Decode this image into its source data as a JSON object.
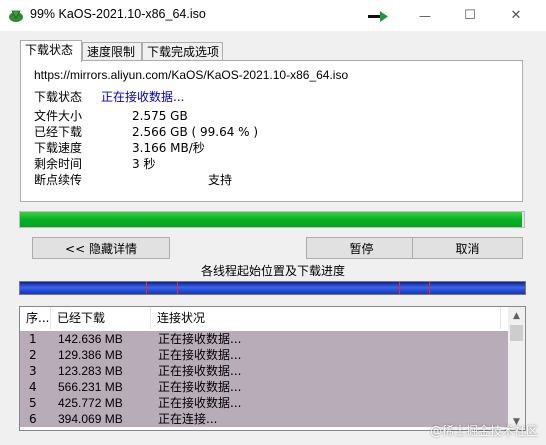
{
  "window": {
    "title": "99% KaOS-2021.10-x86_64.iso",
    "icon": "download-arrow-icon",
    "controls": {
      "minimize": "—",
      "maximize": "☐",
      "close": "✕"
    }
  },
  "tabs": [
    {
      "label": "下载状态",
      "active": true
    },
    {
      "label": "速度限制",
      "active": false
    },
    {
      "label": "下载完成选项",
      "active": false
    }
  ],
  "status": {
    "url": "https://mirrors.aliyun.com/KaOS/KaOS-2021.10-x86_64.iso",
    "status_label": "下载状态",
    "status_value": "正在接收数据...",
    "rows": [
      {
        "label": "文件大小",
        "value": "2.575  GB"
      },
      {
        "label": "已经下载",
        "value": "2.566  GB  ( 99.64 % )"
      },
      {
        "label": "下载速度",
        "value": "3.166  MB/秒"
      },
      {
        "label": "剩余时间",
        "value": "3 秒"
      },
      {
        "label": "断点续传",
        "value": "支持"
      }
    ]
  },
  "progress": {
    "percent": 99.64,
    "color": "#06b025"
  },
  "buttons": {
    "hide_details": "<< 隐藏详情",
    "pause": "暂停",
    "cancel": "取消"
  },
  "threads": {
    "label": "各线程起始位置及下载进度",
    "markers": [
      0.25,
      0.31,
      0.75,
      0.81
    ],
    "marker_color": "#ff2020"
  },
  "table": {
    "headers": [
      "序...",
      "已经下载",
      "连接状况"
    ],
    "rows": [
      {
        "num": "1",
        "size": "142.636  MB",
        "status": "正在接收数据..."
      },
      {
        "num": "2",
        "size": "129.386  MB",
        "status": "正在接收数据..."
      },
      {
        "num": "3",
        "size": "123.283  MB",
        "status": "正在接收数据..."
      },
      {
        "num": "4",
        "size": "566.231  MB",
        "status": "正在接收数据..."
      },
      {
        "num": "5",
        "size": "425.772  MB",
        "status": "正在接收数据..."
      },
      {
        "num": "6",
        "size": "394.069  MB",
        "status": "正在连接..."
      }
    ],
    "row_color": "#b9acb9"
  },
  "watermark": "@稀土掘金技术社区"
}
